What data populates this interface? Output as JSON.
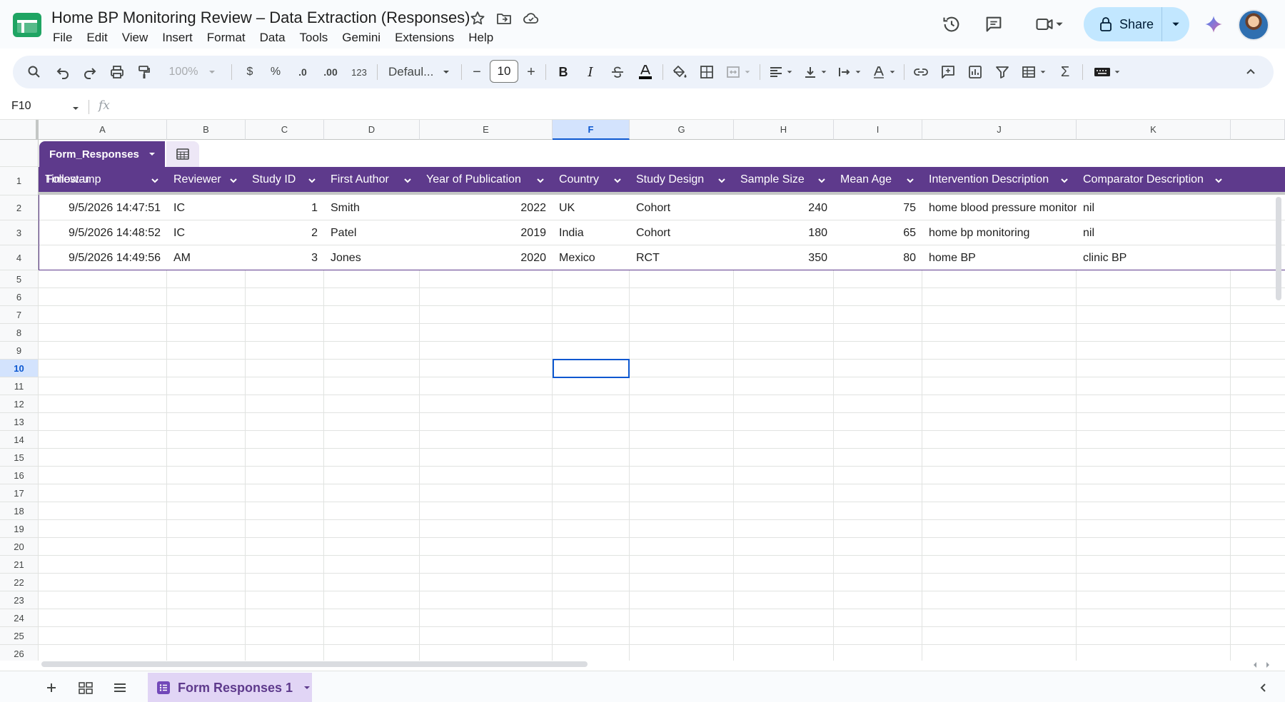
{
  "window": {
    "title": "Home BP Monitoring Review – Data Extraction (Responses)"
  },
  "menu": [
    "File",
    "Edit",
    "View",
    "Insert",
    "Format",
    "Data",
    "Tools",
    "Gemini",
    "Extensions",
    "Help"
  ],
  "header": {
    "share_label": "Share"
  },
  "toolbar": {
    "zoom": "100%",
    "currency": "$",
    "percent": "%",
    "decrease_decimal": ".0",
    "increase_decimal": ".00",
    "number_format": "123",
    "font": "Defaul...",
    "font_size": "10",
    "font_size_decrease": "−",
    "font_size_increase": "+",
    "bold": "B",
    "italic": "I",
    "sum": "Σ"
  },
  "formula_bar": {
    "name_box": "F10",
    "fx": "fx",
    "value": ""
  },
  "columns": [
    "A",
    "B",
    "C",
    "D",
    "E",
    "F",
    "G",
    "H",
    "I",
    "J",
    "K"
  ],
  "active_column": "F",
  "active_row": "10",
  "rows": [
    "1",
    "2",
    "3",
    "4",
    "5",
    "6",
    "7",
    "8",
    "9",
    "10",
    "11",
    "12",
    "13",
    "14",
    "15",
    "16",
    "17",
    "18",
    "19",
    "20",
    "21",
    "22",
    "23",
    "24",
    "25",
    "26"
  ],
  "table": {
    "name": "Form_Responses",
    "headers": [
      "Timestamp",
      "Reviewer",
      "Study ID",
      "First Author",
      "Year of Publication",
      "Country",
      "Study Design",
      "Sample Size",
      "Mean Age",
      "Intervention Description",
      "Comparator Description",
      "Follow-u"
    ],
    "records": [
      [
        "9/5/2026 14:47:51",
        "IC",
        "1",
        "Smith",
        "2022",
        "UK",
        "Cohort",
        "240",
        "75",
        "home blood pressure monitoring",
        "nil"
      ],
      [
        "9/5/2026 14:48:52",
        "IC",
        "2",
        "Patel",
        "2019",
        "India",
        "Cohort",
        "180",
        "65",
        "home bp monitoring",
        "nil"
      ],
      [
        "9/5/2026 14:49:56",
        "AM",
        "3",
        "Jones",
        "2020",
        "Mexico",
        "RCT",
        "350",
        "80",
        "home BP",
        "clinic BP"
      ]
    ]
  },
  "sheet_tab": {
    "label": "Form Responses 1"
  },
  "colors": {
    "table_header": "#5e3a8c",
    "accent": "#0b57d0",
    "share_bg": "#c2e7ff"
  }
}
